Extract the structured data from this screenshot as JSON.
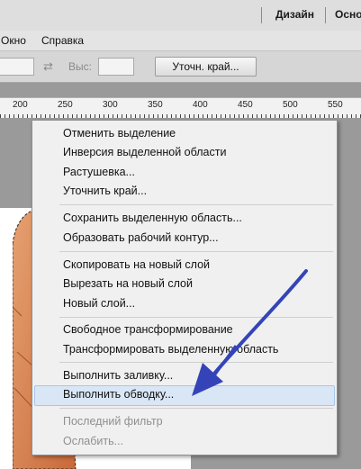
{
  "topbar": {
    "workspace_design": "Дизайн",
    "workspace_basic": "Осно"
  },
  "menubar": {
    "window": "Окно",
    "help": "Справка"
  },
  "options": {
    "height_label": "Выс:",
    "refine_edge_button": "Уточн. край..."
  },
  "ruler": {
    "labels": [
      "200",
      "250",
      "300",
      "350",
      "400",
      "450",
      "500",
      "550"
    ]
  },
  "context_menu": {
    "items": [
      {
        "label": "Отменить выделение",
        "enabled": true
      },
      {
        "label": "Инверсия выделенной области",
        "enabled": true
      },
      {
        "label": "Растушевка...",
        "enabled": true
      },
      {
        "label": "Уточнить край...",
        "enabled": true
      },
      {
        "label": "Сохранить выделенную область...",
        "enabled": true
      },
      {
        "label": "Образовать рабочий контур...",
        "enabled": true
      },
      {
        "label": "Скопировать на новый слой",
        "enabled": true
      },
      {
        "label": "Вырезать на новый слой",
        "enabled": true
      },
      {
        "label": "Новый слой...",
        "enabled": true
      },
      {
        "label": "Свободное трансформирование",
        "enabled": true
      },
      {
        "label": "Трансформировать выделенную область",
        "enabled": true
      },
      {
        "label": "Выполнить заливку...",
        "enabled": true
      },
      {
        "label": "Выполнить обводку...",
        "enabled": true,
        "highlighted": true
      },
      {
        "label": "Последний фильтр",
        "enabled": false
      },
      {
        "label": "Ослабить...",
        "enabled": false
      }
    ]
  },
  "colors": {
    "highlight": "#d9e6f5",
    "arrow": "#3444b8",
    "skin": "#d9834f"
  }
}
